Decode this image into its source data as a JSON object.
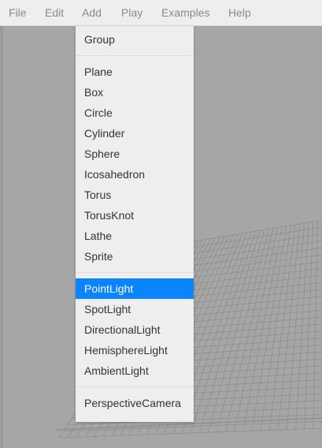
{
  "menubar": {
    "items": [
      {
        "label": "File"
      },
      {
        "label": "Edit"
      },
      {
        "label": "Add"
      },
      {
        "label": "Play"
      },
      {
        "label": "Examples"
      },
      {
        "label": "Help"
      }
    ]
  },
  "add_menu": {
    "group_1": [
      "Group"
    ],
    "group_2": [
      "Plane",
      "Box",
      "Circle",
      "Cylinder",
      "Sphere",
      "Icosahedron",
      "Torus",
      "TorusKnot",
      "Lathe",
      "Sprite"
    ],
    "group_3": [
      "PointLight",
      "SpotLight",
      "DirectionalLight",
      "HemisphereLight",
      "AmbientLight"
    ],
    "group_4": [
      "PerspectiveCamera"
    ],
    "highlighted_item": "PointLight"
  },
  "colors": {
    "menubar_bg": "#eeeeee",
    "menubar_text": "#8a8a8a",
    "menu_bg": "#eeeeee",
    "menu_text": "#333333",
    "highlight_bg": "#0a84ff",
    "highlight_text": "#ffffff",
    "viewport_bg": "#a6a6a6",
    "grid_line": "#8e8e8e"
  }
}
